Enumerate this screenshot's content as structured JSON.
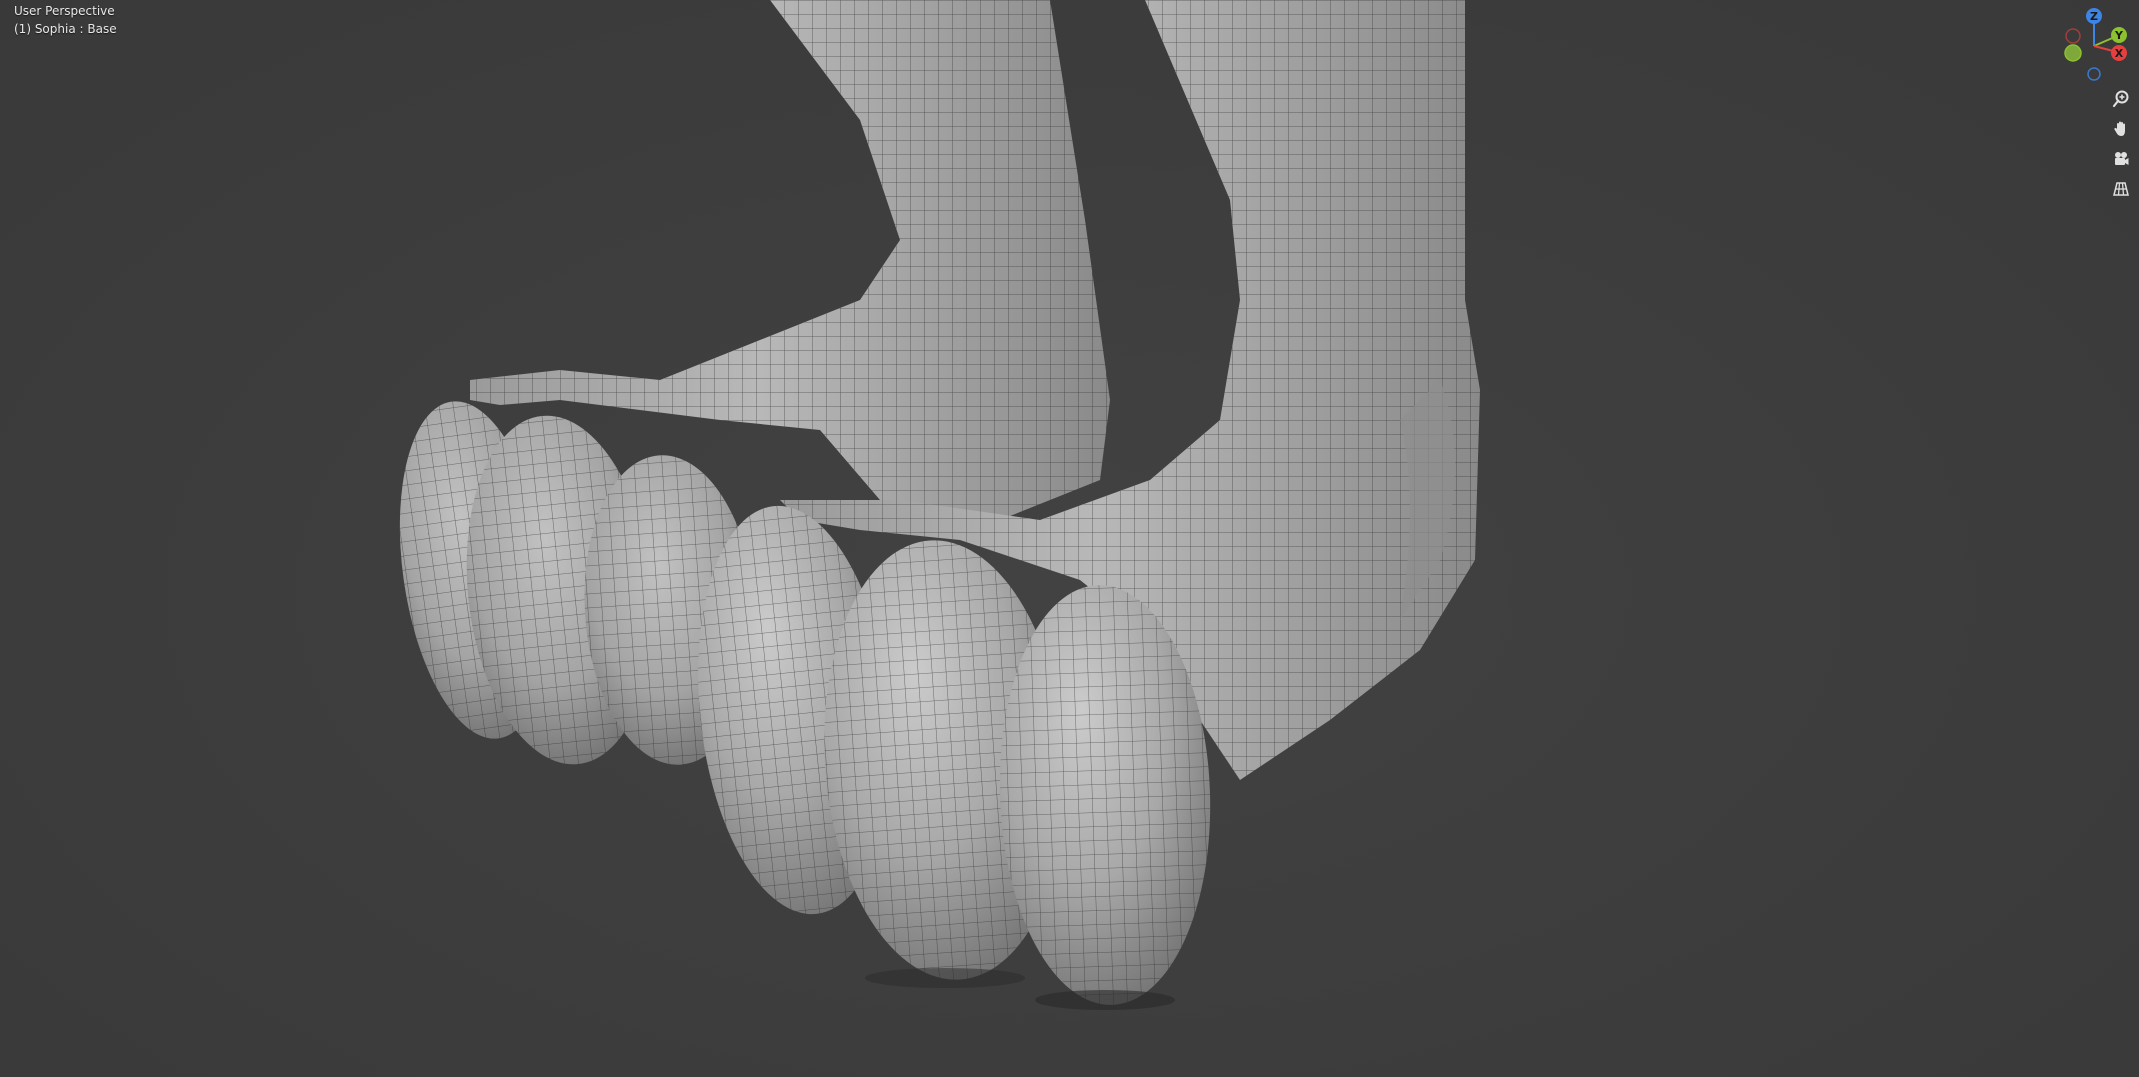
{
  "viewport": {
    "view_title": "User Perspective",
    "object_info": "(1) Sophia : Base",
    "background_color": "#3d3d3d",
    "mesh_color": "#a7a7a7",
    "wire_color": "#2b2b2b"
  },
  "gizmo": {
    "z_label": "Z",
    "y_label": "Y",
    "x_label": "X",
    "x_color": "#e5403f",
    "y_color": "#8bc22e",
    "z_color": "#3c84e5"
  },
  "nav_buttons": [
    {
      "name": "zoom-icon"
    },
    {
      "name": "hand-pan-icon"
    },
    {
      "name": "camera-view-icon"
    },
    {
      "name": "grid-ortho-icon"
    }
  ]
}
